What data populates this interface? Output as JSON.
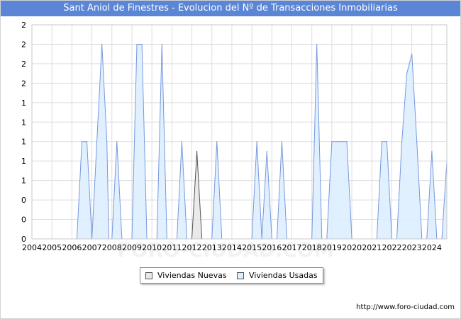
{
  "title": "Sant Aniol de Finestres - Evolucion del Nº de Transacciones Inmobiliarias",
  "footer": "http://www.foro-ciudad.com",
  "watermark": "FORO-CIUDAD.COM",
  "legend": {
    "nuevas": "Viviendas Nuevas",
    "usadas": "Viviendas Usadas"
  },
  "colors": {
    "title_bg": "#5b86d6",
    "usadas_fill": "#ddeeff",
    "usadas_stroke": "#7799dd",
    "nuevas_fill": "#e8e8e8",
    "nuevas_stroke": "#555555",
    "grid": "#dddddd"
  },
  "chart_data": {
    "type": "area",
    "title": "Sant Aniol de Finestres - Evolucion del Nº de Transacciones Inmobiliarias",
    "xlabel": "",
    "ylabel": "",
    "x_tick_labels": [
      "2004",
      "2005",
      "2006",
      "2007",
      "2008",
      "2009",
      "2010",
      "2011",
      "2012",
      "2013",
      "2014",
      "2015",
      "2016",
      "2017",
      "2018",
      "2019",
      "2020",
      "2021",
      "2022",
      "2023",
      "2024"
    ],
    "y_tick_labels": [
      "0",
      "0",
      "0",
      "1",
      "1",
      "1",
      "1",
      "1",
      "2",
      "2",
      "2",
      "2"
    ],
    "ylim": [
      0,
      2.2
    ],
    "xlim": [
      2004.0,
      2024.75
    ],
    "grid": true,
    "legend_position": "bottom",
    "series": [
      {
        "name": "Viviendas Nuevas",
        "points": [
          [
            2012.0,
            0
          ],
          [
            2012.25,
            0.9
          ],
          [
            2012.5,
            0
          ]
        ]
      },
      {
        "name": "Viviendas Usadas",
        "points": [
          [
            2006.25,
            0
          ],
          [
            2006.5,
            1
          ],
          [
            2006.75,
            1
          ],
          [
            2007.0,
            0
          ],
          [
            2007.25,
            1
          ],
          [
            2007.5,
            2
          ],
          [
            2007.75,
            1
          ],
          [
            2007.85,
            0
          ],
          [
            2008.0,
            0
          ],
          [
            2008.25,
            1
          ],
          [
            2008.5,
            0
          ],
          [
            2009.0,
            0
          ],
          [
            2009.25,
            2
          ],
          [
            2009.5,
            2
          ],
          [
            2009.75,
            0
          ],
          [
            2010.25,
            0
          ],
          [
            2010.5,
            2
          ],
          [
            2010.75,
            0
          ],
          [
            2011.25,
            0
          ],
          [
            2011.5,
            1
          ],
          [
            2011.75,
            0
          ],
          [
            2013.0,
            0
          ],
          [
            2013.25,
            1
          ],
          [
            2013.5,
            0
          ],
          [
            2015.0,
            0
          ],
          [
            2015.25,
            1
          ],
          [
            2015.5,
            0
          ],
          [
            2015.5,
            0
          ],
          [
            2015.75,
            0.9
          ],
          [
            2016.0,
            0
          ],
          [
            2016.25,
            0
          ],
          [
            2016.5,
            1
          ],
          [
            2016.75,
            0
          ],
          [
            2018.0,
            0
          ],
          [
            2018.25,
            2
          ],
          [
            2018.5,
            0
          ],
          [
            2018.75,
            0
          ],
          [
            2019.0,
            1
          ],
          [
            2019.25,
            1
          ],
          [
            2019.5,
            1
          ],
          [
            2019.75,
            1
          ],
          [
            2020.0,
            0
          ],
          [
            2021.25,
            0
          ],
          [
            2021.5,
            1
          ],
          [
            2021.75,
            1
          ],
          [
            2022.0,
            0
          ],
          [
            2022.25,
            0
          ],
          [
            2022.5,
            1
          ],
          [
            2022.75,
            1.7
          ],
          [
            2023.0,
            1.9
          ],
          [
            2023.25,
            1
          ],
          [
            2023.5,
            0
          ],
          [
            2023.75,
            0
          ],
          [
            2024.0,
            0.9
          ],
          [
            2024.25,
            0
          ],
          [
            2024.5,
            0
          ],
          [
            2024.75,
            0.8
          ]
        ]
      }
    ]
  }
}
